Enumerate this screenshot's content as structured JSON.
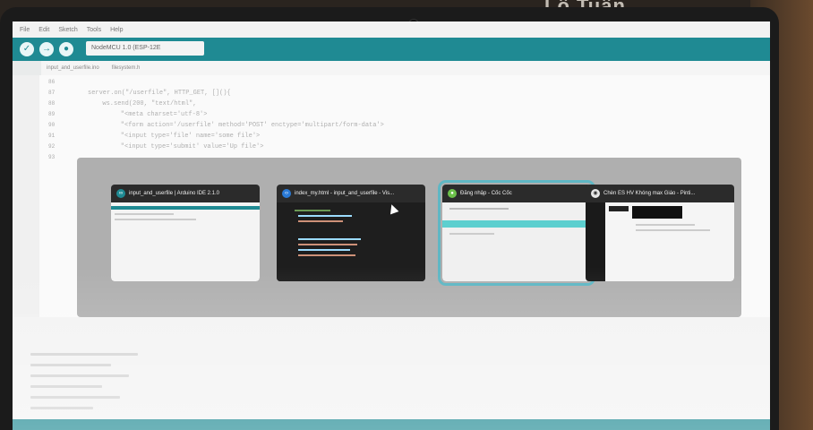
{
  "background_text": "Lô Tuấn",
  "ide": {
    "menu": [
      "File",
      "Edit",
      "Sketch",
      "Tools",
      "Help"
    ],
    "board": "NodeMCU 1.0 (ESP-12E",
    "tabs": [
      "input_and_userfile.ino",
      "filesystem.h"
    ],
    "line_numbers": [
      "86",
      "87",
      "88",
      "89",
      "90",
      "91",
      "92",
      "93"
    ],
    "code": [
      "server.on(\"/userfile\", HTTP_GET, [](){",
      "  ws.send(200, \"text/html\",",
      "    \"<meta charset='utf-8'>",
      "    \"<form action='/userfile' method='POST' enctype='multipart/form-data'>",
      "    \"<input type='file' name='some file'>",
      "    \"<input type='submit' value='Up file'>"
    ]
  },
  "switcher": {
    "windows": [
      {
        "title": "input_and_userfile | Arduino IDE 2.1.0",
        "icon": "arduino-icon",
        "selected": false
      },
      {
        "title": "index_my.html - input_and_userfile - Vis...",
        "icon": "vscode-icon",
        "selected": false
      },
      {
        "title": "Đăng nhập - Cốc Cốc",
        "icon": "coccoc-icon",
        "selected": true
      },
      {
        "title": "Chèn ES HV Khóng max Giáo - Pinti...",
        "icon": "chrome-icon",
        "selected": false
      }
    ]
  },
  "colors": {
    "accent": "#1f8a93",
    "selection": "#5fb7c4"
  }
}
